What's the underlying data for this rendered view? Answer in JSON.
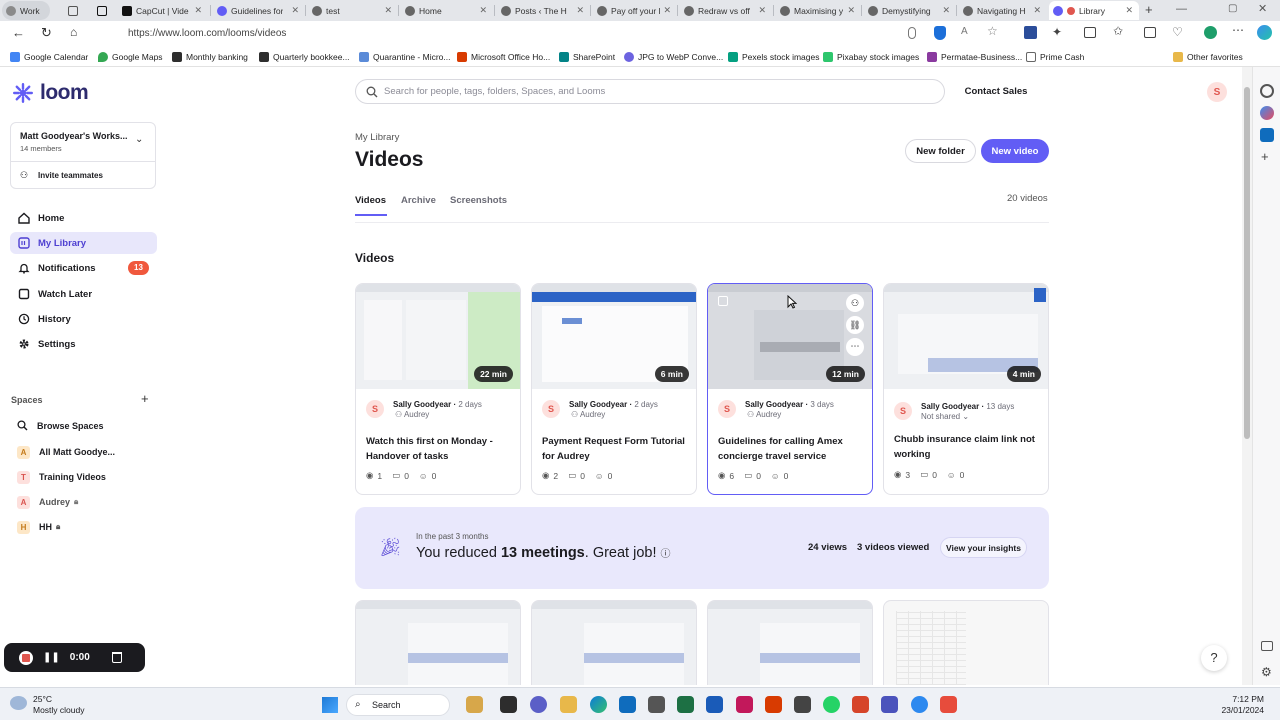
{
  "browser": {
    "tabs": [
      {
        "title": "Work",
        "fav": "#6d6d6d"
      },
      {
        "title": "",
        "fav": "#6d6d6d"
      },
      {
        "title": "",
        "fav": "#111111"
      },
      {
        "title": "CapCut | Vide",
        "fav": "#111111"
      },
      {
        "title": "Guidelines for",
        "fav": "#625df5"
      },
      {
        "title": "test",
        "fav": "#555555"
      },
      {
        "title": "Home",
        "fav": "#555555"
      },
      {
        "title": "Posts ‹ The H",
        "fav": "#555555"
      },
      {
        "title": "Pay off your l",
        "fav": "#555555"
      },
      {
        "title": "Redraw vs off",
        "fav": "#555555"
      },
      {
        "title": "Maximising y",
        "fav": "#555555"
      },
      {
        "title": "Demystifying",
        "fav": "#555555"
      },
      {
        "title": "Navigating H",
        "fav": "#555555"
      },
      {
        "title": "Library",
        "fav": "#e0574f"
      }
    ],
    "url": "https://www.loom.com/looms/videos",
    "bookmarks": [
      {
        "label": "Google Calendar",
        "color": "#4285f4"
      },
      {
        "label": "Google Maps",
        "color": "#34a853"
      },
      {
        "label": "Monthly banking",
        "color": "#2e2e2e"
      },
      {
        "label": "Quarterly bookkee...",
        "color": "#2e2e2e"
      },
      {
        "label": "Quarantine - Micro...",
        "color": "#5b8bd8"
      },
      {
        "label": "Microsoft Office Ho...",
        "color": "#d83b01"
      },
      {
        "label": "SharePoint",
        "color": "#038387"
      },
      {
        "label": "JPG to WebP Conve...",
        "color": "#6c63e0"
      },
      {
        "label": "Pexels stock images",
        "color": "#05a081"
      },
      {
        "label": "Pixabay stock images",
        "color": "#2ec66d"
      },
      {
        "label": "Permatae-Business...",
        "color": "#8a3a9f"
      },
      {
        "label": "Prime Cash",
        "color": "#666666"
      }
    ],
    "other_favorites": "Other favorites"
  },
  "sidebar": {
    "brand": "loom",
    "workspace_name": "Matt Goodyear's Works...",
    "workspace_members": "14 members",
    "invite_label": "Invite teammates",
    "nav": [
      {
        "label": "Home",
        "icon": "home-icon"
      },
      {
        "label": "My Library",
        "icon": "library-icon",
        "active": true
      },
      {
        "label": "Notifications",
        "icon": "bell-icon",
        "badge": "13"
      },
      {
        "label": "Watch Later",
        "icon": "bookmark-icon"
      },
      {
        "label": "History",
        "icon": "history-icon"
      },
      {
        "label": "Settings",
        "icon": "gear-icon"
      }
    ],
    "spaces_heading": "Spaces",
    "spaces": [
      {
        "label": "Browse Spaces",
        "letter": ""
      },
      {
        "label": "All Matt Goodye...",
        "letter": "A",
        "bg": "#fde7c7",
        "fg": "#c47a1a"
      },
      {
        "label": "Training Videos",
        "letter": "T",
        "bg": "#fde0dd",
        "fg": "#d9534f"
      },
      {
        "label": "Audrey",
        "letter": "A",
        "bg": "#fde0dd",
        "fg": "#d9534f",
        "locked": true
      },
      {
        "label": "HH",
        "letter": "H",
        "bg": "#fde7c7",
        "fg": "#c47a1a",
        "locked": true
      }
    ]
  },
  "header": {
    "search_placeholder": "Search for people, tags, folders, Spaces, and Looms",
    "contact_sales": "Contact Sales",
    "user_initial": "S"
  },
  "page": {
    "breadcrumb": "My Library",
    "title": "Videos",
    "new_folder": "New folder",
    "new_video": "New video",
    "tabs": [
      "Videos",
      "Archive",
      "Screenshots"
    ],
    "count": "20 videos",
    "section_title": "Videos"
  },
  "videos": [
    {
      "duration": "22 min",
      "author": "Sally Goodyear",
      "ago": "2 days",
      "share": "Audrey",
      "title": "Watch this first on Monday - Handover of tasks",
      "views": "1",
      "comments": "0",
      "reactions": "0"
    },
    {
      "duration": "6 min",
      "author": "Sally Goodyear",
      "ago": "2 days",
      "share": "Audrey",
      "title": "Payment Request Form Tutorial for Audrey",
      "views": "2",
      "comments": "0",
      "reactions": "0"
    },
    {
      "duration": "12 min",
      "author": "Sally Goodyear",
      "ago": "3 days",
      "share": "Audrey",
      "title": "Guidelines for calling Amex concierge travel service",
      "views": "6",
      "comments": "0",
      "reactions": "0"
    },
    {
      "duration": "4 min",
      "author": "Sally Goodyear",
      "ago": "13 days",
      "share": "Not shared",
      "title": "Chubb insurance claim link not working",
      "views": "3",
      "comments": "0",
      "reactions": "0"
    }
  ],
  "insights": {
    "period": "In the past 3 months",
    "prefix": "You reduced ",
    "meetings": "13 meetings",
    "suffix": ". Great job!",
    "views": "24 views",
    "videos_viewed": "3 videos viewed",
    "cta": "View your insights"
  },
  "recorder": {
    "time": "0:00"
  },
  "taskbar": {
    "temp": "25°C",
    "weather": "Mostly cloudy",
    "search": "Search",
    "time": "7:12 PM",
    "date": "23/01/2024"
  },
  "colors": {
    "accent": "#625df5",
    "brand": "#2d2b6e",
    "badge": "#f0583d"
  }
}
